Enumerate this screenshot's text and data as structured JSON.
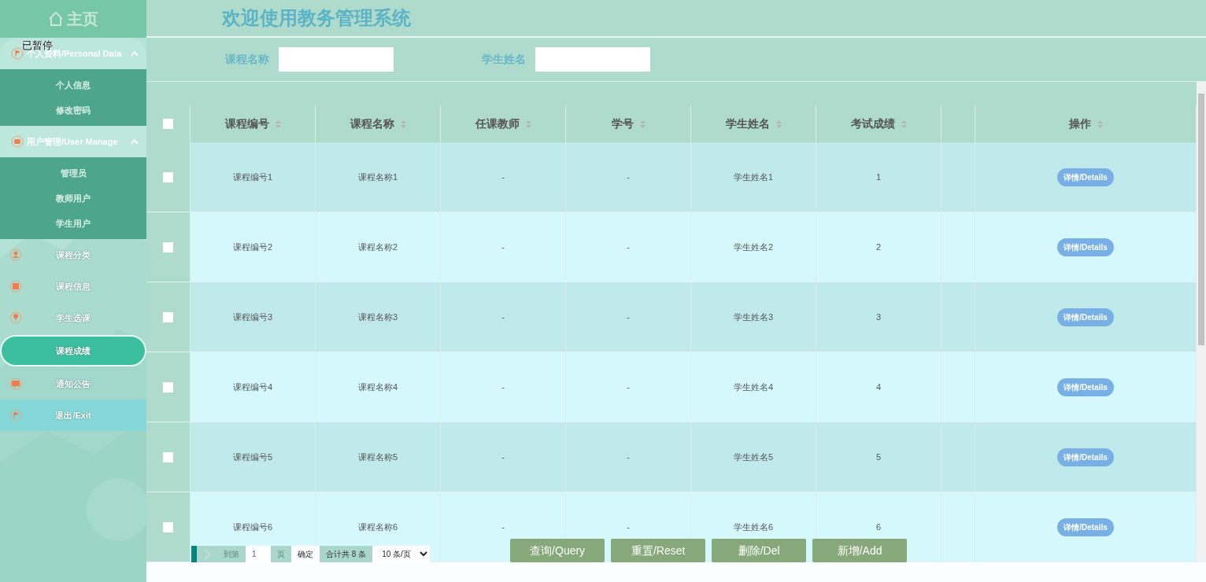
{
  "sidebar": {
    "home": "主页",
    "overlay_label": "已暂停",
    "menu": [
      {
        "kind": "group",
        "label": "个人资料/Personal Data",
        "expanded": true,
        "children": [
          {
            "label": "个人信息",
            "selected": false
          },
          {
            "label": "修改密码",
            "selected": false
          }
        ]
      },
      {
        "kind": "group",
        "label": "用户管理/User Manage",
        "expanded": true,
        "children": [
          {
            "label": "管理员",
            "selected": false
          },
          {
            "label": "教师用户",
            "selected": false
          },
          {
            "label": "学生用户",
            "selected": false
          }
        ]
      },
      {
        "kind": "item",
        "label": "课程分类",
        "selected": false
      },
      {
        "kind": "item",
        "label": "课程信息",
        "selected": false
      },
      {
        "kind": "item",
        "label": "学生选课",
        "selected": false
      },
      {
        "kind": "item",
        "label": "课程成绩",
        "selected": true
      },
      {
        "kind": "item",
        "label": "通知公告",
        "selected": false
      },
      {
        "kind": "exit",
        "label": "退出/Exit",
        "selected": false
      }
    ]
  },
  "header": {
    "title": "欢迎使用教务管理系统"
  },
  "search": [
    {
      "label": "课程名称"
    },
    {
      "label": "学生姓名"
    }
  ],
  "table": {
    "all_checked": false,
    "columns": [
      "课程编号",
      "课程名称",
      "任课教师",
      "学号",
      "学生姓名",
      "考试成绩",
      "",
      "操作"
    ],
    "rows": [
      {
        "checked": false,
        "cells": [
          "课程编号1",
          "课程名称1",
          "-",
          "-",
          "学生姓名1",
          "1"
        ],
        "action": "详情/Details"
      },
      {
        "checked": false,
        "cells": [
          "课程编号2",
          "课程名称2",
          "-",
          "-",
          "学生姓名2",
          "2"
        ],
        "action": "详情/Details"
      },
      {
        "checked": false,
        "cells": [
          "课程编号3",
          "课程名称3",
          "-",
          "-",
          "学生姓名3",
          "3"
        ],
        "action": "详情/Details"
      },
      {
        "checked": false,
        "cells": [
          "课程编号4",
          "课程名称4",
          "-",
          "-",
          "学生姓名4",
          "4"
        ],
        "action": "详情/Details"
      },
      {
        "checked": false,
        "cells": [
          "课程编号5",
          "课程名称5",
          "-",
          "-",
          "学生姓名5",
          "5"
        ],
        "action": "详情/Details"
      },
      {
        "checked": false,
        "cells": [
          "课程编号6",
          "课程名称6",
          "-",
          "-",
          "学生姓名6",
          "6"
        ],
        "action": "详情/Details"
      }
    ]
  },
  "pagination": {
    "goto_label": "到第",
    "page": "1",
    "page_unit": "页",
    "confirm": "确定",
    "total": "合计共 8 条",
    "page_size": "10 条/页"
  },
  "buttons": [
    "查询/Query",
    "重置/Reset",
    "删除/Del",
    "新增/Add"
  ]
}
